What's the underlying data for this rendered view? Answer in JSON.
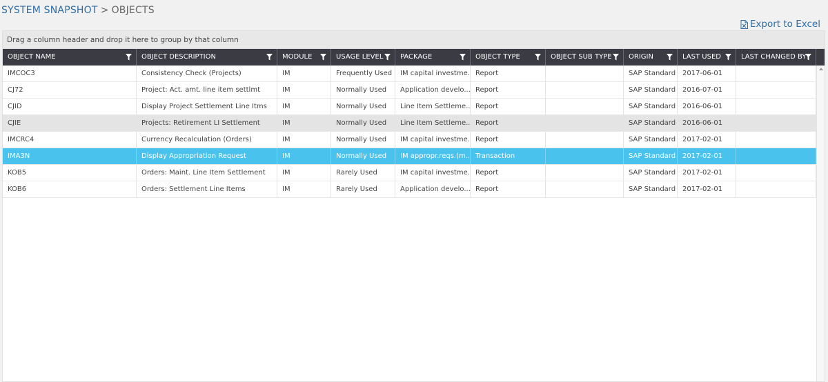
{
  "breadcrumb": {
    "root": "SYSTEM SNAPSHOT",
    "separator": ">",
    "current": "OBJECTS"
  },
  "export": {
    "label": "Export to Excel",
    "icon": "excel-file-icon"
  },
  "grid": {
    "group_hint": "Drag a column header and drop it here to group by that column",
    "columns": [
      "OBJECT NAME",
      "OBJECT DESCRIPTION",
      "MODULE",
      "USAGE LEVEL",
      "PACKAGE",
      "OBJECT TYPE",
      "OBJECT SUB TYPE",
      "ORIGIN",
      "LAST USED",
      "LAST CHANGED BY"
    ],
    "rows": [
      {
        "name": "IMCOC3",
        "description": "Consistency Check (Projects)",
        "module": "IM",
        "usage": "Frequently Used",
        "package": "IM capital investme...",
        "type": "Report",
        "subtype": "",
        "origin": "SAP Standard",
        "last_used": "2017-06-01",
        "changed_by": ""
      },
      {
        "name": "CJ72",
        "description": "Project: Act. amt. line item settlmt",
        "module": "IM",
        "usage": "Normally Used",
        "package": "Application develo...",
        "type": "Report",
        "subtype": "",
        "origin": "SAP Standard",
        "last_used": "2016-07-01",
        "changed_by": ""
      },
      {
        "name": "CJID",
        "description": "Display Project Settlement Line Itms",
        "module": "IM",
        "usage": "Normally Used",
        "package": "Line Item Settleme...",
        "type": "Report",
        "subtype": "",
        "origin": "SAP Standard",
        "last_used": "2016-06-01",
        "changed_by": ""
      },
      {
        "name": "CJIE",
        "description": "Projects: Retirement LI Settlement",
        "module": "IM",
        "usage": "Normally Used",
        "package": "Line Item Settleme...",
        "type": "Report",
        "subtype": "",
        "origin": "SAP Standard",
        "last_used": "2016-06-01",
        "changed_by": ""
      },
      {
        "name": "IMCRC4",
        "description": "Currency Recalculation (Orders)",
        "module": "IM",
        "usage": "Normally Used",
        "package": "IM capital investme...",
        "type": "Report",
        "subtype": "",
        "origin": "SAP Standard",
        "last_used": "2017-02-01",
        "changed_by": ""
      },
      {
        "name": "IMA3N",
        "description": "Display Appropriation Request",
        "module": "IM",
        "usage": "Normally Used",
        "package": "IM appropr.reqs.(m...",
        "type": "Transaction",
        "subtype": "",
        "origin": "SAP Standard",
        "last_used": "2017-02-01",
        "changed_by": ""
      },
      {
        "name": "KOB5",
        "description": "Orders: Maint. Line Item Settlement",
        "module": "IM",
        "usage": "Rarely Used",
        "package": "IM capital investme...",
        "type": "Report",
        "subtype": "",
        "origin": "SAP Standard",
        "last_used": "2017-02-01",
        "changed_by": ""
      },
      {
        "name": "KOB6",
        "description": "Orders: Settlement Line Items",
        "module": "IM",
        "usage": "Rarely Used",
        "package": "Application develo...",
        "type": "Report",
        "subtype": "",
        "origin": "SAP Standard",
        "last_used": "2017-02-01",
        "changed_by": ""
      }
    ],
    "row_states": [
      "normal",
      "normal",
      "normal",
      "hover",
      "normal",
      "selected",
      "normal",
      "normal"
    ],
    "colors": {
      "header_bg": "#3b3b44",
      "selected_bg": "#49c3ee",
      "hover_bg": "#e4e4e4",
      "link": "#2e6da4"
    }
  }
}
